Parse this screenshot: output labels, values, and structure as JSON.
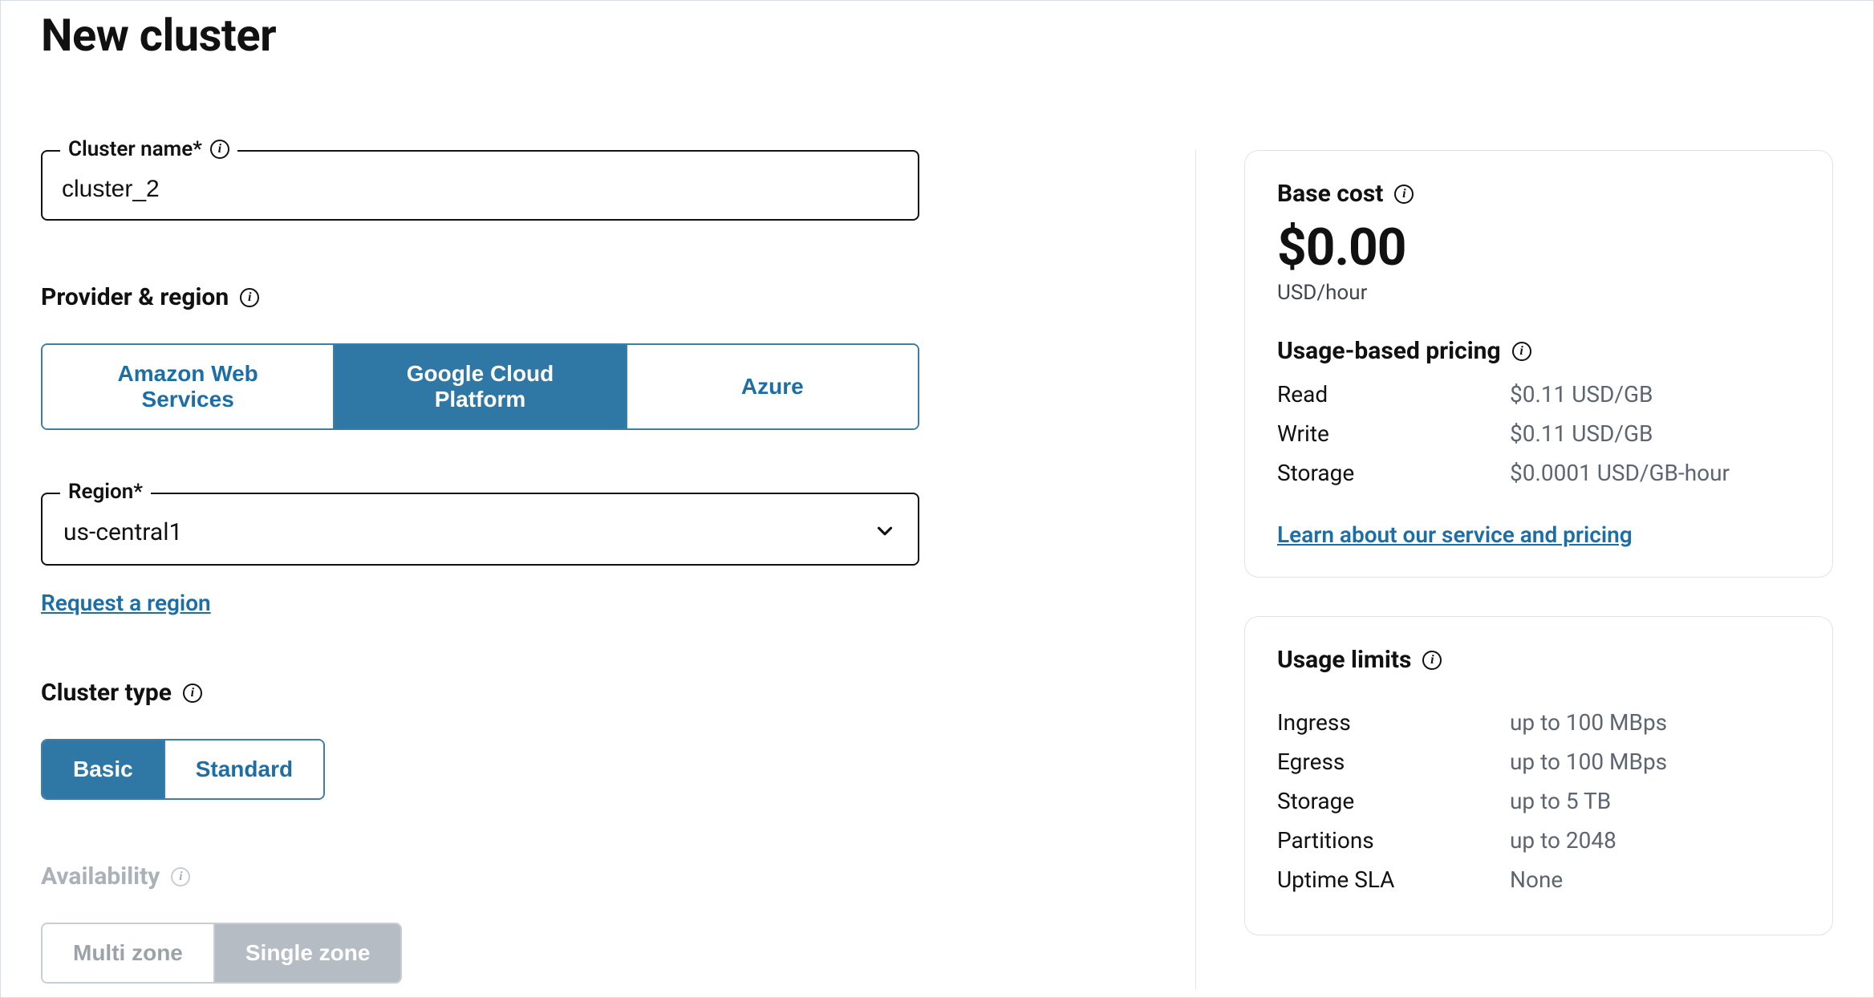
{
  "page": {
    "title": "New cluster"
  },
  "form": {
    "cluster_name": {
      "label": "Cluster name*",
      "value": "cluster_2"
    },
    "provider_region": {
      "heading": "Provider & region",
      "options": {
        "aws": "Amazon Web Services",
        "gcp": "Google Cloud Platform",
        "azure": "Azure"
      },
      "selected": "gcp"
    },
    "region": {
      "label": "Region*",
      "value": "us-central1",
      "request_link": "Request a region"
    },
    "cluster_type": {
      "heading": "Cluster type",
      "options": {
        "basic": "Basic",
        "standard": "Standard"
      },
      "selected": "basic"
    },
    "availability": {
      "heading": "Availability",
      "options": {
        "multi": "Multi zone",
        "single": "Single zone"
      },
      "selected": "single",
      "disabled": true
    }
  },
  "cost_card": {
    "base_cost_heading": "Base cost",
    "price": "$0.00",
    "unit": "USD/hour",
    "usage_heading": "Usage-based pricing",
    "rows": {
      "read": {
        "label": "Read",
        "value": "$0.11 USD/GB"
      },
      "write": {
        "label": "Write",
        "value": "$0.11 USD/GB"
      },
      "storage": {
        "label": "Storage",
        "value": "$0.0001 USD/GB-hour"
      }
    },
    "learn_link": "Learn about our service and pricing"
  },
  "limits_card": {
    "heading": "Usage limits",
    "rows": {
      "ingress": {
        "label": "Ingress",
        "value": "up to 100 MBps"
      },
      "egress": {
        "label": "Egress",
        "value": "up to 100 MBps"
      },
      "storage": {
        "label": "Storage",
        "value": "up to 5 TB"
      },
      "partitions": {
        "label": "Partitions",
        "value": "up to 2048"
      },
      "sla": {
        "label": "Uptime SLA",
        "value": "None"
      }
    }
  }
}
